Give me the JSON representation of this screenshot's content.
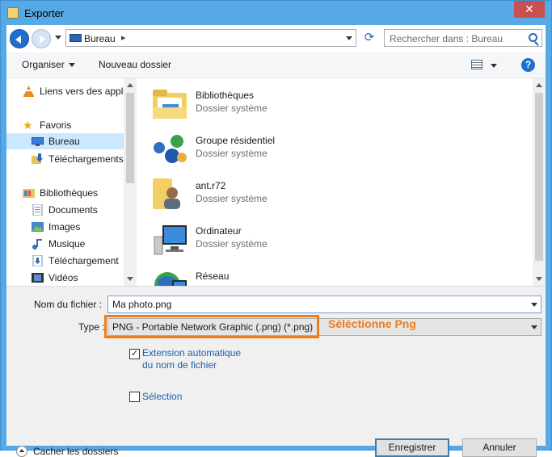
{
  "window": {
    "title": "Exporter",
    "close_glyph": "✕"
  },
  "nav": {
    "address_location": "Bureau",
    "address_separator": "▸",
    "search_placeholder": "Rechercher dans : Bureau",
    "refresh_glyph": "⟳"
  },
  "toolbar": {
    "organize_label": "Organiser",
    "new_folder_label": "Nouveau dossier",
    "help_glyph": "?"
  },
  "sidebar": {
    "items": [
      {
        "label": "Liens vers des appli",
        "icon": "vlc-icon",
        "selected": false
      },
      {
        "label": "Favoris",
        "icon": "star-icon",
        "selected": false
      },
      {
        "label": "Bureau",
        "icon": "desktop-icon",
        "selected": true
      },
      {
        "label": "Téléchargements",
        "icon": "downloads-icon",
        "selected": false
      },
      {
        "label": "Bibliothèques",
        "icon": "libraries-icon",
        "selected": false
      },
      {
        "label": "Documents",
        "icon": "documents-icon",
        "selected": false
      },
      {
        "label": "Images",
        "icon": "images-icon",
        "selected": false
      },
      {
        "label": "Musique",
        "icon": "music-icon",
        "selected": false
      },
      {
        "label": "Téléchargement",
        "icon": "download-icon",
        "selected": false
      },
      {
        "label": "Vidéos",
        "icon": "videos-icon",
        "selected": false
      }
    ]
  },
  "content": {
    "items": [
      {
        "name": "Bibliothèques",
        "type": "Dossier système",
        "icon": "libraries-folder-icon"
      },
      {
        "name": "Groupe résidentiel",
        "type": "Dossier système",
        "icon": "homegroup-icon"
      },
      {
        "name": "ant.r72",
        "type": "Dossier système",
        "icon": "user-folder-icon"
      },
      {
        "name": "Ordinateur",
        "type": "Dossier système",
        "icon": "computer-icon"
      },
      {
        "name": "Réseau",
        "type": "",
        "icon": "network-icon"
      }
    ]
  },
  "form": {
    "filename_label": "Nom du fichier :",
    "filename_value": "Ma photo.png",
    "type_label": "Type :",
    "type_value": "PNG - Portable Network Graphic (.png) (*.png)",
    "annotation": "Séléctionne Png",
    "annotation_color": "#f07d1a",
    "auto_extension_label": "Extension automatique du nom de fichier",
    "auto_extension_checked": true,
    "selection_label": "Sélection",
    "selection_checked": false,
    "hide_folders_label": "Cacher les dossiers",
    "save_label": "Enregistrer",
    "cancel_label": "Annuler"
  },
  "colors": {
    "accent": "#1e6fd0",
    "window_frame": "#57a9e6",
    "selected_row": "#cce8ff"
  }
}
